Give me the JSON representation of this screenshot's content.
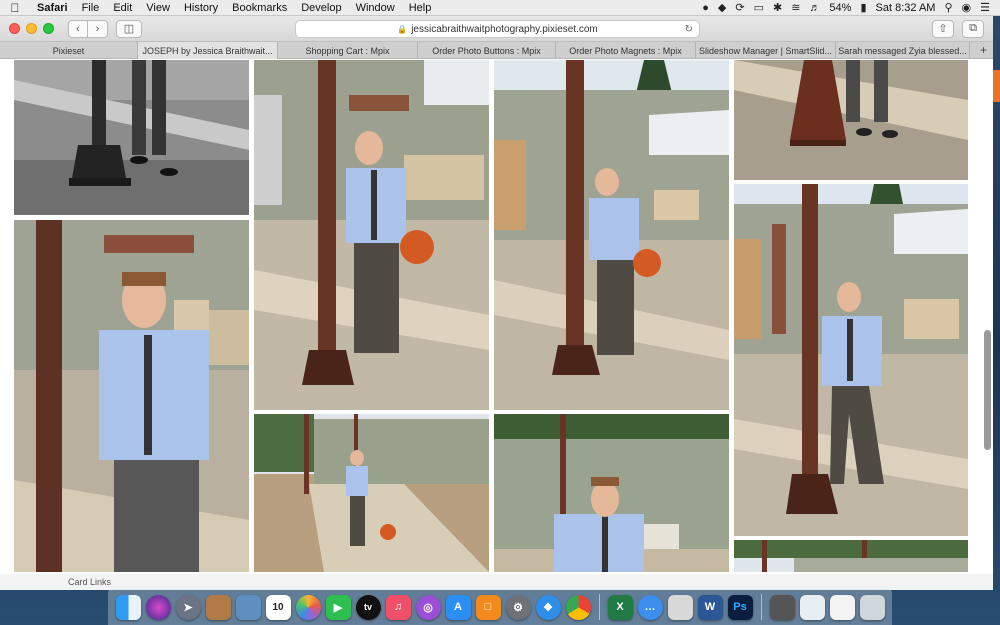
{
  "menubar": {
    "apple_icon": "apple-icon",
    "app_name": "Safari",
    "menus": [
      "File",
      "Edit",
      "View",
      "History",
      "Bookmarks",
      "Develop",
      "Window",
      "Help"
    ],
    "battery": "54%",
    "clock": "Sat 8:32 AM"
  },
  "browser": {
    "url": "jessicabraithwaitphotography.pixieset.com",
    "tabs": [
      {
        "label": "Pixieset"
      },
      {
        "label": "JOSEPH by Jessica Braithwait..."
      },
      {
        "label": "Shopping Cart : Mpix"
      },
      {
        "label": "Order Photo Buttons : Mpix"
      },
      {
        "label": "Order Photo Magnets : Mpix"
      },
      {
        "label": "Slideshow Manager | SmartSlid..."
      },
      {
        "label": "Sarah messaged Zyia blessed..."
      }
    ],
    "new_tab_label": "+"
  },
  "footer_peek": "Card Links",
  "dock": {
    "apps": [
      "Finder",
      "Siri",
      "Launchpad",
      "Contacts",
      "Preview",
      "Calendar",
      "Photos",
      "FaceTime",
      "TV",
      "Music",
      "Podcasts",
      "App Store",
      "Books",
      "System Preferences",
      "Safari",
      "Chrome",
      "Excel",
      "Messages",
      "Calculator Notes",
      "Word",
      "Photoshop",
      "Calculator",
      "Mail Preview",
      "Documents",
      "Trash"
    ],
    "calendar_date": "10",
    "excel_letter": "X",
    "word_letter": "W",
    "photoshop_letter": "Ps"
  },
  "colors": {
    "accent_orange": "#e8732a",
    "desktop_blue": "#1c3552"
  }
}
